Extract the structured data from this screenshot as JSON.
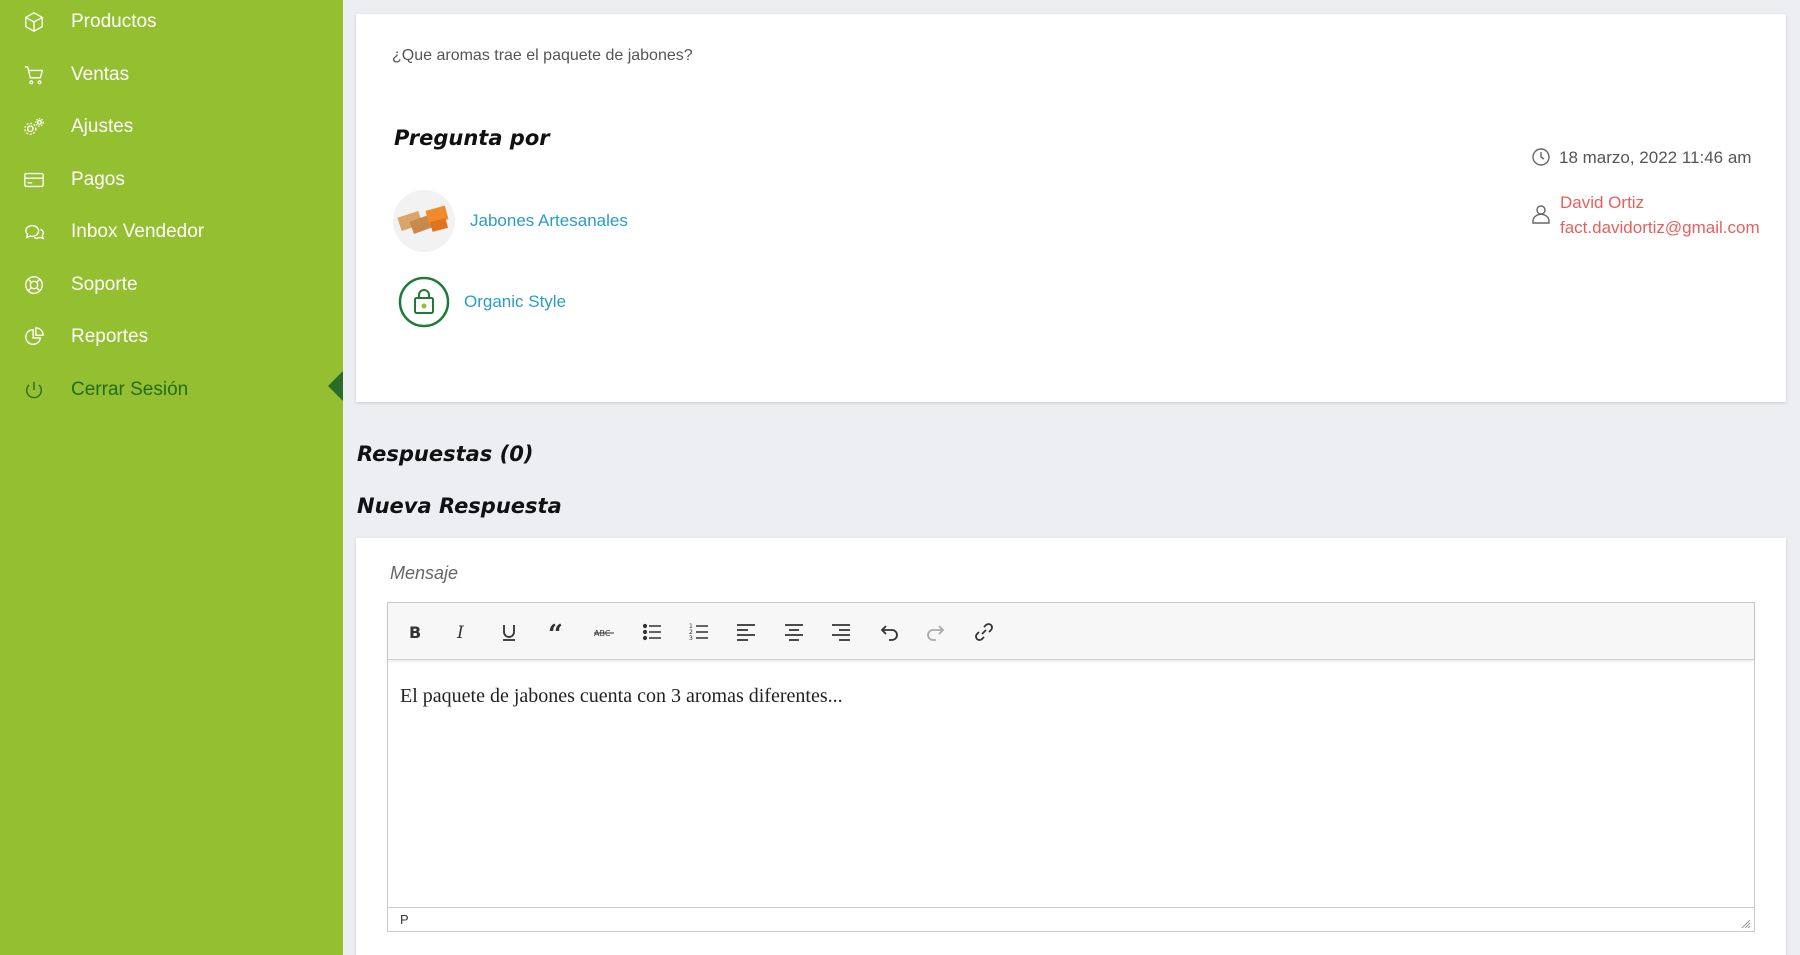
{
  "sidebar": {
    "items": [
      {
        "label": "Productos",
        "icon": "cube-icon"
      },
      {
        "label": "Ventas",
        "icon": "cart-icon"
      },
      {
        "label": "Ajustes",
        "icon": "gears-icon"
      },
      {
        "label": "Pagos",
        "icon": "credit-card-icon"
      },
      {
        "label": "Inbox Vendedor",
        "icon": "chat-icon"
      },
      {
        "label": "Soporte",
        "icon": "lifebuoy-icon"
      },
      {
        "label": "Reportes",
        "icon": "pie-chart-icon"
      },
      {
        "label": "Cerrar Sesión",
        "icon": "power-icon",
        "active": true
      }
    ],
    "colors": {
      "background": "#94bf30",
      "active_text": "#246b1e"
    }
  },
  "question": {
    "text": "¿Que aromas trae el paquete de jabones?",
    "title": "Pregunta por",
    "product_name": "Jabones Artesanales",
    "store_name": "Organic Style",
    "date": "18 marzo, 2022 11:46 am",
    "user_name": "David Ortiz",
    "user_email": "fact.davidortiz@gmail.com"
  },
  "answers": {
    "title": "Respuestas (0)",
    "new_title": "Nueva Respuesta"
  },
  "editor": {
    "label": "Mensaje",
    "content": "El paquete de jabones cuenta con 3 aromas diferentes...",
    "status_path": "P",
    "toolbar": [
      "bold-icon",
      "italic-icon",
      "underline-icon",
      "blockquote-icon",
      "strikethrough-icon",
      "bullet-list-icon",
      "numbered-list-icon",
      "align-left-icon",
      "align-center-icon",
      "align-right-icon",
      "undo-icon",
      "redo-icon",
      "link-icon"
    ]
  },
  "colors": {
    "link": "#2a9dc7",
    "user": "#e8605d",
    "page_bg": "#eceef2"
  }
}
